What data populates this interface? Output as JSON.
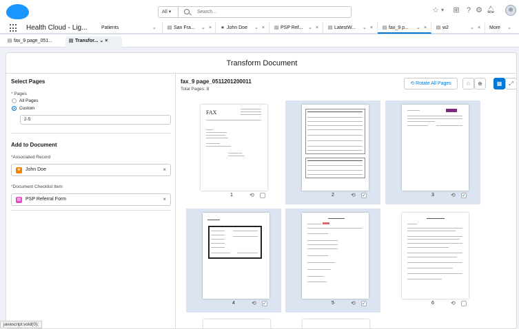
{
  "search": {
    "scope": "All",
    "placeholder": "Search..."
  },
  "nav": {
    "app_name": "Health Cloud - Lig...",
    "tabs": [
      {
        "label": "Patients",
        "icon": ""
      },
      {
        "label": "San Fra...",
        "icon": "doc-icon"
      },
      {
        "label": "John Doe",
        "icon": "person-icon"
      },
      {
        "label": "PSP Ref...",
        "icon": "doc-icon"
      },
      {
        "label": "LatestW...",
        "icon": "doc-icon"
      },
      {
        "label": "fax_9 p...",
        "icon": "doc-icon"
      },
      {
        "label": "w2",
        "icon": "doc-icon"
      },
      {
        "label": "More",
        "icon": ""
      }
    ]
  },
  "subtabs": [
    {
      "label": "fax_9 page_051..."
    },
    {
      "label": "Transfor..."
    }
  ],
  "modal": {
    "title": "Transform Document"
  },
  "left": {
    "select_pages_heading": "Select Pages",
    "pages_label": "Pages",
    "all_pages_option": "All Pages",
    "custom_option": "Custom",
    "custom_value": "2-5",
    "add_to_document_heading": "Add to Document",
    "associated_record_label": "Associated Record",
    "associated_record_value": "John Doe",
    "checklist_label": "Document Checklist Item",
    "checklist_value": "PSP Referral Form"
  },
  "document": {
    "name": "fax_9 page_0511201200011",
    "total_pages": "Total Pages: 8",
    "rotate_all_label": "Rotate All Pages"
  },
  "pages": [
    {
      "number": "1",
      "selected": false
    },
    {
      "number": "2",
      "selected": true
    },
    {
      "number": "3",
      "selected": true
    },
    {
      "number": "4",
      "selected": true
    },
    {
      "number": "5",
      "selected": true
    },
    {
      "number": "6",
      "selected": false
    }
  ],
  "page_text": {
    "fax_header": "FAX"
  },
  "status_bar": "javascript:void(0);",
  "colors": {
    "brand": "#1b96ff",
    "accent": "#0176d3",
    "selected_page_bg": "#dbe4f0",
    "record_icon": "#f38303",
    "checklist_icon": "#e14ec3"
  }
}
